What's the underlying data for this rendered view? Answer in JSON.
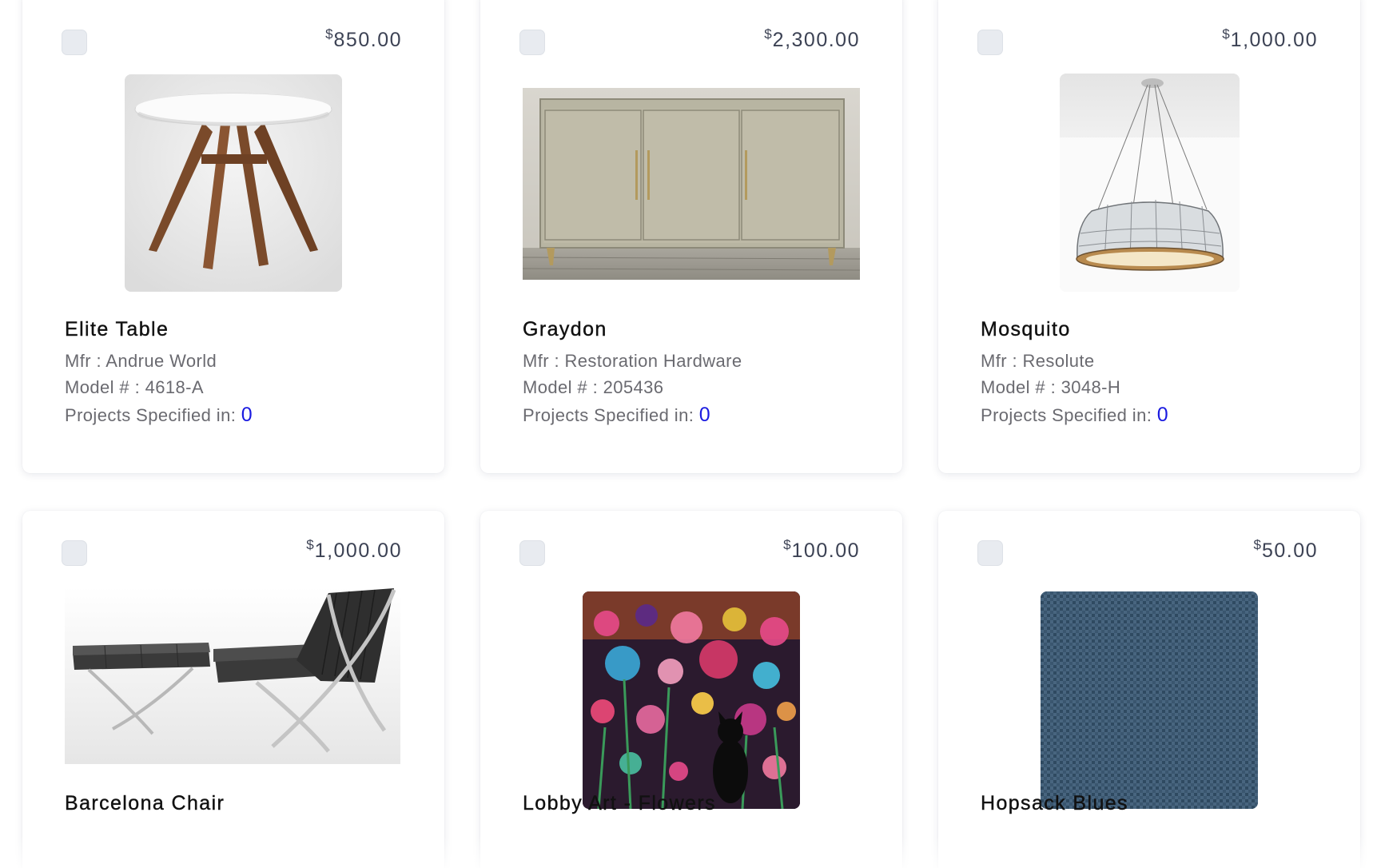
{
  "products": [
    {
      "price_symbol": "$",
      "price": "850.00",
      "name": "Elite Table",
      "mfr": "Mfr : Andrue World",
      "model": "Model # : 4618-A",
      "projects_label": "Projects Specified in: ",
      "projects_count": "0",
      "image": "round-dining-table"
    },
    {
      "price_symbol": "$",
      "price": "2,300.00",
      "name": "Graydon",
      "mfr": "Mfr : Restoration Hardware",
      "model": "Model # : 205436",
      "projects_label": "Projects Specified in: ",
      "projects_count": "0",
      "image": "sideboard-cabinet"
    },
    {
      "price_symbol": "$",
      "price": "1,000.00",
      "name": "Mosquito",
      "mfr": "Mfr : Resolute",
      "model": "Model # : 3048-H",
      "projects_label": "Projects Specified in: ",
      "projects_count": "0",
      "image": "pendant-lamp"
    },
    {
      "price_symbol": "$",
      "price": "1,000.00",
      "name": "Barcelona Chair",
      "image": "lounge-chair-ottoman"
    },
    {
      "price_symbol": "$",
      "price": "100.00",
      "name": "Lobby Art - Flowers",
      "image": "floral-painting"
    },
    {
      "price_symbol": "$",
      "price": "50.00",
      "name": "Hopsack Blues",
      "image": "blue-fabric-swatch"
    }
  ],
  "colors": {
    "card_bg": "#ffffff",
    "price_text": "#3c4254",
    "meta_text": "#6a6a70",
    "count_link": "#1a1ae0",
    "checkbox_bg": "#e8ebf0"
  }
}
